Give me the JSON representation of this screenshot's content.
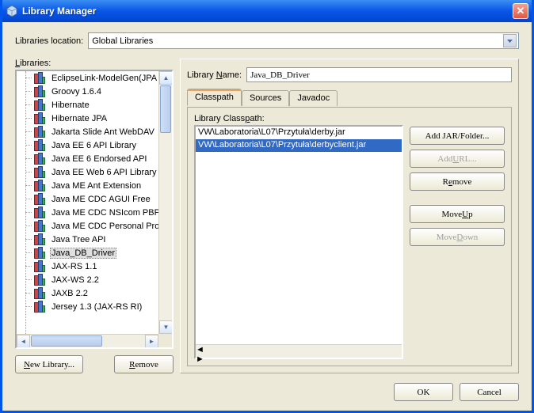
{
  "window": {
    "title": "Library Manager"
  },
  "location": {
    "label": "Libraries location:",
    "value": "Global Libraries"
  },
  "libraries": {
    "label": "Libraries:",
    "items": [
      "EclipseLink-ModelGen(JPA",
      "Groovy 1.6.4",
      "Hibernate",
      "Hibernate JPA",
      "Jakarta Slide Ant WebDAV",
      "Java EE 6 API Library",
      "Java EE 6 Endorsed API",
      "Java EE Web 6 API Library",
      "Java ME Ant Extension",
      "Java ME CDC AGUI Free",
      "Java ME CDC NSIcom PBP",
      "Java ME CDC Personal Profile",
      "Java Tree API",
      "Java_DB_Driver",
      "JAX-RS 1.1",
      "JAX-WS 2.2",
      "JAXB 2.2",
      "Jersey 1.3 (JAX-RS RI)"
    ],
    "selected_index": 13
  },
  "buttons": {
    "new_library": "New Library...",
    "list_remove": "Remove",
    "add_jar": "Add JAR/Folder...",
    "add_url": "Add URL...",
    "cp_remove": "Remove",
    "move_up": "Move Up",
    "move_down": "Move Down",
    "ok": "OK",
    "cancel": "Cancel"
  },
  "detail": {
    "name_label": "Library Name:",
    "name_value": "Java_DB_Driver",
    "tabs": [
      "Classpath",
      "Sources",
      "Javadoc"
    ],
    "active_tab": 0,
    "classpath_label": "Library Classpath:",
    "classpath_items": [
      "VW\\Laboratoria\\L07\\Przytuła\\derby.jar",
      "VW\\Laboratoria\\L07\\Przytuła\\derbyclient.jar"
    ],
    "classpath_selected_index": 1
  }
}
